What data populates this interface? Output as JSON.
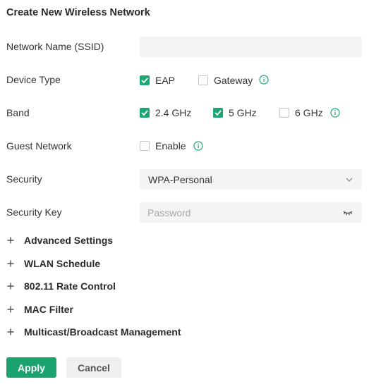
{
  "form": {
    "title": "Create New Wireless Network",
    "ssid": {
      "label": "Network Name (SSID)",
      "value": "",
      "placeholder": ""
    },
    "device_type": {
      "label": "Device Type",
      "options": [
        {
          "label": "EAP",
          "checked": true
        },
        {
          "label": "Gateway",
          "checked": false
        }
      ],
      "info_icon": "info-circle-icon"
    },
    "band": {
      "label": "Band",
      "options": [
        {
          "label": "2.4 GHz",
          "checked": true
        },
        {
          "label": "5 GHz",
          "checked": true
        },
        {
          "label": "6 GHz",
          "checked": false
        }
      ],
      "info_icon": "info-circle-icon"
    },
    "guest_network": {
      "label": "Guest Network",
      "option": {
        "label": "Enable",
        "checked": false
      },
      "info_icon": "info-circle-icon"
    },
    "security": {
      "label": "Security",
      "selected": "WPA-Personal",
      "icon": "chevron-down-icon"
    },
    "security_key": {
      "label": "Security Key",
      "value": "",
      "placeholder": "Password",
      "icon": "eye-closed-icon"
    }
  },
  "sections": [
    {
      "label": "Advanced Settings",
      "icon": "plus-icon"
    },
    {
      "label": "WLAN Schedule",
      "icon": "plus-icon"
    },
    {
      "label": "802.11 Rate Control",
      "icon": "plus-icon"
    },
    {
      "label": "MAC Filter",
      "icon": "plus-icon"
    },
    {
      "label": "Multicast/Broadcast Management",
      "icon": "plus-icon"
    }
  ],
  "buttons": {
    "apply_label": "Apply",
    "cancel_label": "Cancel"
  },
  "colors": {
    "accent": "#1ba672",
    "input_bg": "#f4f4f4",
    "cancel_bg": "#f0f0f0",
    "text": "#333333"
  }
}
